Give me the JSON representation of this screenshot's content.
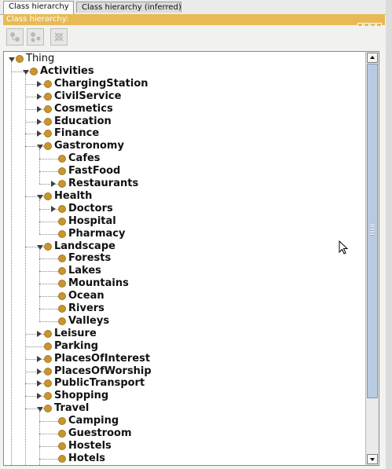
{
  "tabs": [
    {
      "label": "Class hierarchy",
      "active": true
    },
    {
      "label": "Class hierarchy (inferred)",
      "active": false
    }
  ],
  "panel": {
    "title": "Class hierarchy:"
  },
  "toolbar": {
    "buttons": [
      {
        "name": "add-subclass-button",
        "icon": "add-subclass-icon"
      },
      {
        "name": "add-sibling-button",
        "icon": "add-sibling-icon"
      },
      {
        "name": "delete-class-button",
        "icon": "delete-class-icon"
      }
    ]
  },
  "colors": {
    "accent": "#e8ba55",
    "class_dot": "#c8952f",
    "scroll_thumb": "#b8cbe3"
  },
  "tree": [
    {
      "label": "Thing",
      "depth": 0,
      "state": "open"
    },
    {
      "label": "Activities",
      "depth": 1,
      "state": "open"
    },
    {
      "label": "ChargingStation",
      "depth": 2,
      "state": "closed"
    },
    {
      "label": "CivilService",
      "depth": 2,
      "state": "closed"
    },
    {
      "label": "Cosmetics",
      "depth": 2,
      "state": "closed"
    },
    {
      "label": "Education",
      "depth": 2,
      "state": "closed"
    },
    {
      "label": "Finance",
      "depth": 2,
      "state": "closed"
    },
    {
      "label": "Gastronomy",
      "depth": 2,
      "state": "open"
    },
    {
      "label": "Cafes",
      "depth": 3,
      "state": "leaf"
    },
    {
      "label": "FastFood",
      "depth": 3,
      "state": "leaf"
    },
    {
      "label": "Restaurants",
      "depth": 3,
      "state": "closed"
    },
    {
      "label": "Health",
      "depth": 2,
      "state": "open"
    },
    {
      "label": "Doctors",
      "depth": 3,
      "state": "closed"
    },
    {
      "label": "Hospital",
      "depth": 3,
      "state": "leaf"
    },
    {
      "label": "Pharmacy",
      "depth": 3,
      "state": "leaf"
    },
    {
      "label": "Landscape",
      "depth": 2,
      "state": "open"
    },
    {
      "label": "Forests",
      "depth": 3,
      "state": "leaf"
    },
    {
      "label": "Lakes",
      "depth": 3,
      "state": "leaf"
    },
    {
      "label": "Mountains",
      "depth": 3,
      "state": "leaf"
    },
    {
      "label": "Ocean",
      "depth": 3,
      "state": "leaf"
    },
    {
      "label": "Rivers",
      "depth": 3,
      "state": "leaf"
    },
    {
      "label": "Valleys",
      "depth": 3,
      "state": "leaf"
    },
    {
      "label": "Leisure",
      "depth": 2,
      "state": "closed"
    },
    {
      "label": "Parking",
      "depth": 2,
      "state": "leaf"
    },
    {
      "label": "PlacesOfInterest",
      "depth": 2,
      "state": "closed"
    },
    {
      "label": "PlacesOfWorship",
      "depth": 2,
      "state": "closed"
    },
    {
      "label": "PublicTransport",
      "depth": 2,
      "state": "closed"
    },
    {
      "label": "Shopping",
      "depth": 2,
      "state": "closed"
    },
    {
      "label": "Travel",
      "depth": 2,
      "state": "open"
    },
    {
      "label": "Camping",
      "depth": 3,
      "state": "leaf"
    },
    {
      "label": "Guestroom",
      "depth": 3,
      "state": "leaf"
    },
    {
      "label": "Hostels",
      "depth": 3,
      "state": "leaf"
    },
    {
      "label": "Hotels",
      "depth": 3,
      "state": "leaf"
    }
  ]
}
